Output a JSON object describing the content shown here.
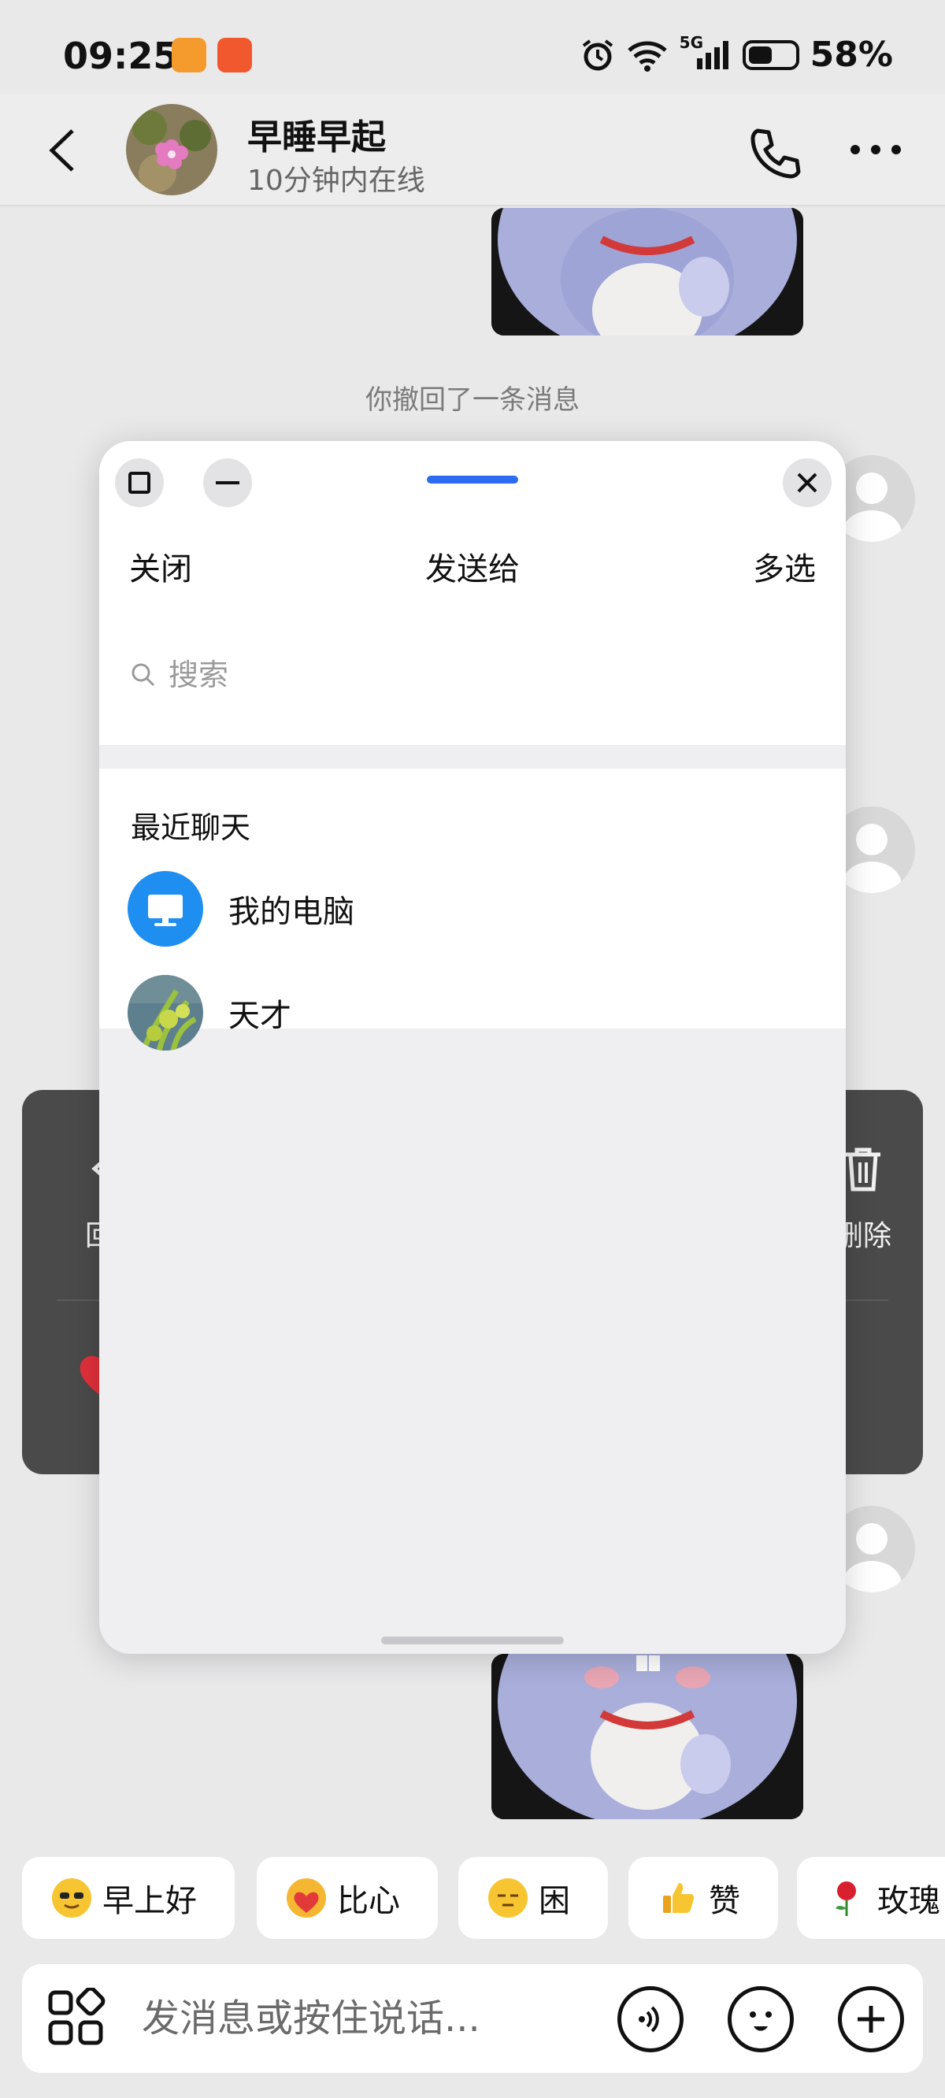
{
  "status_bar": {
    "time": "09:25",
    "network": "5G",
    "battery": "58%",
    "battery_level": 0.58,
    "icons": [
      "alarm-icon",
      "wifi-icon",
      "signal-icon",
      "battery-icon"
    ]
  },
  "header": {
    "contact_name": "早睡早起",
    "contact_status": "10分钟内在线",
    "icons": [
      "back-icon",
      "phone-icon",
      "more-icon"
    ]
  },
  "chat": {
    "recall_notice": "你撤回了一条消息",
    "context_menu_left": "回",
    "context_menu_right": "删除"
  },
  "share_sheet": {
    "close_label": "关闭",
    "title": "发送给",
    "multi_select_label": "多选",
    "search_placeholder": "搜索",
    "recent_title": "最近聊天",
    "contacts": [
      {
        "name": "我的电脑",
        "icon": "computer-icon"
      },
      {
        "name": "天才",
        "icon": "plant-photo-avatar"
      }
    ],
    "accent_color": "#2d6cf0"
  },
  "quick_replies": [
    {
      "label": "早上好",
      "icon": "sunglasses-sun-emoji"
    },
    {
      "label": "比心",
      "icon": "heart-hands-emoji"
    },
    {
      "label": "困",
      "icon": "sleepy-face-emoji"
    },
    {
      "label": "赞",
      "icon": "thumbs-up-emoji"
    },
    {
      "label": "玫瑰",
      "icon": "rose-emoji"
    }
  ],
  "input_bar": {
    "placeholder": "发消息或按住说话...",
    "icons": [
      "apps-grid-icon",
      "voice-icon",
      "emoji-icon",
      "plus-icon"
    ]
  }
}
